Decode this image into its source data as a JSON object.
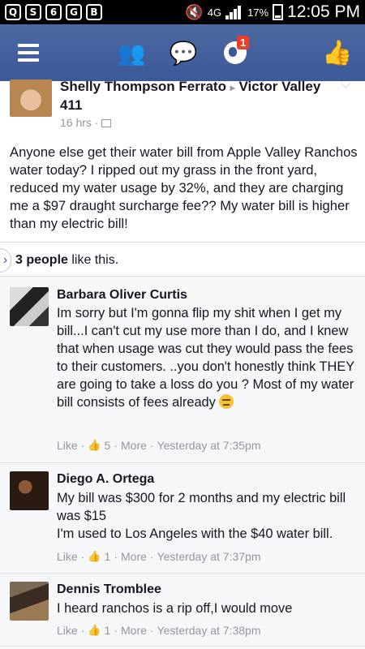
{
  "status_bar": {
    "icons": [
      "Q",
      "S",
      "6",
      "G",
      "B"
    ],
    "network": "4G",
    "battery": "17%",
    "time": "12:05 PM"
  },
  "top_bar": {
    "notification_badge": "1"
  },
  "post": {
    "author": "Shelly Thompson Ferrato",
    "separator": "▸",
    "group": "Victor Valley 411",
    "time": "16 hrs ·",
    "text": "Anyone else get their water bill from Apple Valley Ranchos water today? I ripped out my grass in the front yard, reduced my water usage by 32%, and they are charging me a $97 draught surcharge fee?? My water bill is higher than my electric bill!",
    "likes_count": "3 people",
    "likes_suffix": " like this."
  },
  "comments": [
    {
      "name": "Barbara Oliver Curtis",
      "text": "Im sorry but I'm gonna flip my shit when I get my bill...I can't cut my use more than I do, and I knew that when usage was cut they would pass the fees to their customers. ..you don't honestly think THEY are going to take a loss do you ? Most of my water bill consists of fees already",
      "like": "Like",
      "likes": "5",
      "more": "More",
      "time": "Yesterday at 7:35pm"
    },
    {
      "name": "Diego A. Ortega",
      "text": "My bill was $300 for 2 months and my electric bill was $15",
      "text2": "I'm used to Los Angeles with the $40 water bill.",
      "like": "Like",
      "likes": "1",
      "more": "More",
      "time": "Yesterday at 7:37pm"
    },
    {
      "name": "Dennis Tromblee",
      "text": "I heard ranchos is a rip off,I would move",
      "like": "Like",
      "likes": "1",
      "more": "More",
      "time": "Yesterday at 7:38pm"
    }
  ]
}
